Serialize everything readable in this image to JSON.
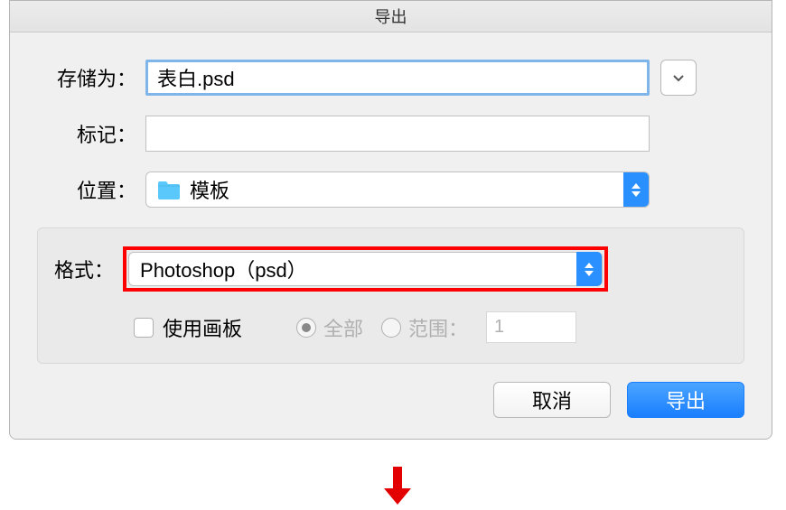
{
  "dialog": {
    "title": "导出",
    "saveAs": {
      "label": "存储为：",
      "value": "表白.psd"
    },
    "tags": {
      "label": "标记：",
      "value": ""
    },
    "location": {
      "label": "位置：",
      "value": "模板"
    },
    "format": {
      "label": "格式：",
      "value": "Photoshop（psd）"
    },
    "artboard": {
      "label": "使用画板",
      "checked": false
    },
    "rangeAll": {
      "label": "全部"
    },
    "rangeCustom": {
      "label": "范围：",
      "value": "1"
    },
    "buttons": {
      "cancel": "取消",
      "export": "导出"
    }
  },
  "colors": {
    "highlight": "#f00",
    "primary": "#2a8fff"
  }
}
